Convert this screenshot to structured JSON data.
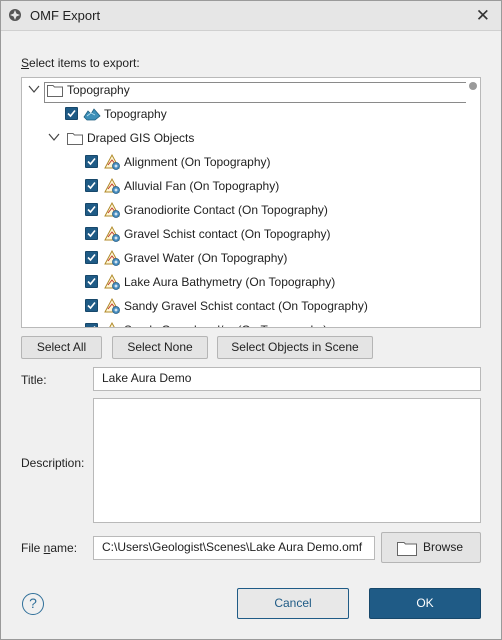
{
  "window": {
    "title": "OMF Export",
    "close_glyph": "✕"
  },
  "select_label": "Select items to export:",
  "tree": {
    "root_label": "Topography",
    "topography_item": "Topography",
    "folder_label": "Draped GIS Objects",
    "items": [
      {
        "label": "Alignment (On Topography)",
        "checked": true
      },
      {
        "label": "Alluvial Fan (On Topography)",
        "checked": true
      },
      {
        "label": "Granodiorite Contact (On Topography)",
        "checked": true
      },
      {
        "label": "Gravel Schist contact (On Topography)",
        "checked": true
      },
      {
        "label": "Gravel Water (On Topography)",
        "checked": true
      },
      {
        "label": "Lake Aura Bathymetry (On Topography)",
        "checked": true
      },
      {
        "label": "Sandy Gravel Schist contact (On Topography)",
        "checked": true
      },
      {
        "label": "Sandy Gravel and/or (On Topography)",
        "checked": true
      }
    ]
  },
  "buttons": {
    "select_all": "Select All",
    "select_none": "Select None",
    "select_objects_in_scene": "Select Objects in Scene",
    "browse": "Browse",
    "cancel": "Cancel",
    "ok": "OK",
    "help": "?"
  },
  "form": {
    "title_label": "Title:",
    "title_value": "Lake Aura Demo",
    "description_label": "Description:",
    "description_value": "",
    "file_name_label": "File name:",
    "file_name_value": "C:\\Users\\Geologist\\Scenes\\Lake Aura Demo.omf"
  },
  "colors": {
    "accent": "#1f5b86",
    "title_bar": "#e6e6e6",
    "background": "#f0f0f0"
  },
  "icons": [
    "app-logo-icon",
    "close-icon",
    "chevron-down-icon",
    "folder-icon",
    "checkbox-icon",
    "surface-icon",
    "gis-object-icon",
    "help-icon"
  ]
}
